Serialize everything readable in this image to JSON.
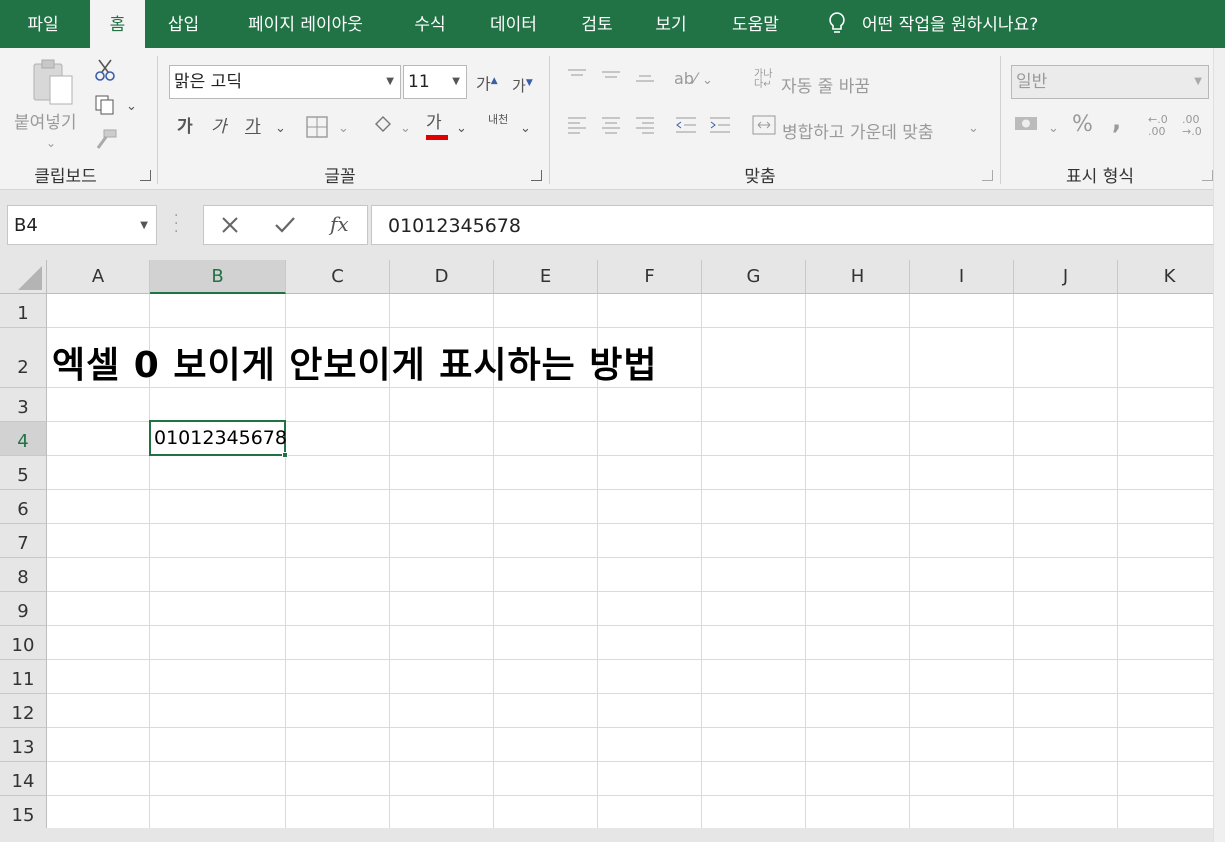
{
  "tabs": [
    "파일",
    "홈",
    "삽입",
    "페이지 레이아웃",
    "수식",
    "데이터",
    "검토",
    "보기",
    "도움말"
  ],
  "active_tab": "홈",
  "tell_me": "어떤 작업을 원하시나요?",
  "ribbon": {
    "clipboard": {
      "paste_label": "붙여넣기",
      "group_label": "클립보드"
    },
    "font": {
      "font_name": "맑은 고딕",
      "font_size": "11",
      "grow_label": "가",
      "shrink_label": "가",
      "bold": "가",
      "italic": "가",
      "underline": "가",
      "font_color_label": "가",
      "font_color": "#e00000",
      "phonetic_label": "내천",
      "group_label": "글꼴"
    },
    "alignment": {
      "wrap_label": "자동 줄 바꿈",
      "merge_label": "병합하고 가운데 맞춤",
      "group_label": "맞춤"
    },
    "number": {
      "format": "일반",
      "percent": "%",
      "comma": ",",
      "inc_decimal": "←.0 .00",
      "dec_decimal": ".00 →.0",
      "group_label": "표시 형식"
    }
  },
  "formula_bar": {
    "name_box": "B4",
    "fx": "fx",
    "content": "01012345678"
  },
  "columns": [
    "A",
    "B",
    "C",
    "D",
    "E",
    "F",
    "G",
    "H",
    "I",
    "J",
    "K"
  ],
  "rows": [
    "1",
    "2",
    "3",
    "4",
    "5",
    "6",
    "7",
    "8",
    "9",
    "10",
    "11",
    "12",
    "13",
    "14",
    "15"
  ],
  "selected_column": "B",
  "selected_row": "4",
  "cells": {
    "A2": "엑셀 0 보이게 안보이게 표시하는 방법",
    "B4": "01012345678"
  },
  "theme": {
    "accent": "#217346"
  }
}
